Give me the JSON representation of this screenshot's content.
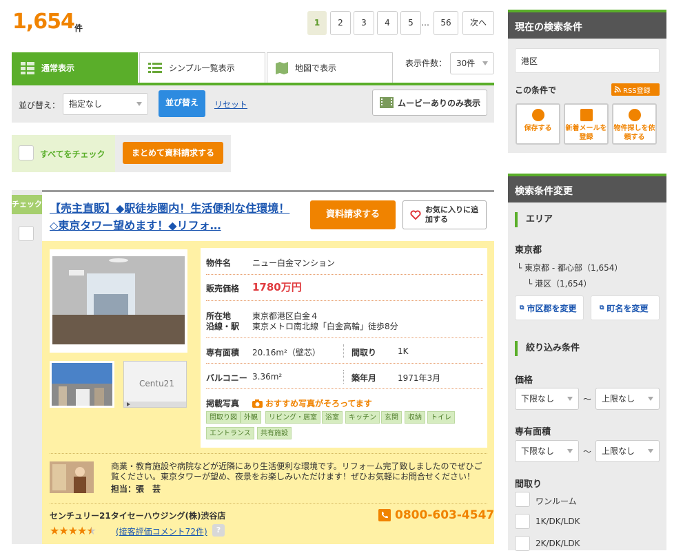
{
  "results": {
    "count": "1,654",
    "unit": "件"
  },
  "pagination": {
    "pages": [
      "1",
      "2",
      "3",
      "4",
      "5"
    ],
    "ellipsis": "…",
    "last": "56",
    "next": "次へ"
  },
  "tabs": [
    {
      "label": "通常表示"
    },
    {
      "label": "シンプル一覧表示"
    },
    {
      "label": "地図で表示"
    }
  ],
  "display_count": {
    "label": "表示件数：",
    "value": "30件"
  },
  "sort": {
    "label": "並び替え：",
    "value": "指定なし",
    "button": "並び替え",
    "reset": "リセット",
    "movie": "ムービーありのみ表示"
  },
  "bulk": {
    "check_all": "すべてをチェック",
    "request_all": "まとめて資料請求する"
  },
  "listing": {
    "check_label": "チェック",
    "title": "【売主直販】◆駅徒歩圏内！生活便利な住環境！◇東京タワー望めます！◆リフォ…",
    "request_button": "資料請求する",
    "favorite_button": "お気に入りに追加する",
    "name_label": "物件名",
    "name": "ニュー白金マンション",
    "price_label": "販売価格",
    "price": "1780万円",
    "address_label": "所在地",
    "address": "東京都港区白金４",
    "station_label": "沿線・駅",
    "station": "東京メトロ南北線「白金高輪」徒歩8分",
    "area_label": "専有面積",
    "area": "20.16m²（壁芯）",
    "layout_label": "間取り",
    "layout": "1K",
    "balcony_label": "バルコニー",
    "balcony": "3.36m²",
    "built_label": "築年月",
    "built": "1971年3月",
    "photos_label": "掲載写真",
    "photos_note": "おすすめ写真がそろってます",
    "photo_tags": [
      "間取り図",
      "外観",
      "リビング・居室",
      "浴室",
      "キッチン",
      "玄関",
      "収納",
      "トイレ",
      "エントランス",
      "共有施設"
    ],
    "comment": "商業・教育施設や病院などが近隣にあり生活便利な環境です。リフォーム完了致しましたのでぜひご覧ください。東京タワーが望め、夜景をお楽しみいただけます！ぜひお気軽にお問合せください！",
    "staff": "担当：張　芸",
    "company": "センチュリー21タイセーハウジング(株)渋谷店",
    "phone": "0800-603-4547",
    "rating_link": "(接客評価コメント72件)",
    "help": "?",
    "rating": 4.5,
    "century21_logo": "Century21"
  },
  "sidebar": {
    "current_title": "現在の検索条件",
    "current_area": "港区",
    "condition_label": "この条件で",
    "rss": "RSS登録",
    "save": "保存する",
    "mail": "新着メールを登録",
    "search_request": "物件探しを依頼する",
    "change_title": "検索条件変更",
    "area_head": "エリア",
    "pref": "東京都",
    "tree1": "└ 東京都 - 都心部（1,654）",
    "tree2": "└ 港区（1,654）",
    "change_city": "市区郡を変更",
    "change_town": "町名を変更",
    "filter_head": "絞り込み条件",
    "price_head": "価格",
    "area2_head": "専有面積",
    "min": "下限なし",
    "max": "上限なし",
    "tilde": "～",
    "layout_head": "間取り",
    "layouts": [
      "ワンルーム",
      "1K/DK/LDK",
      "2K/DK/LDK"
    ]
  },
  "colors": {
    "accent": "#f08300",
    "green": "#5aae2a",
    "price": "#e03a3e",
    "link": "#1a55b0"
  }
}
